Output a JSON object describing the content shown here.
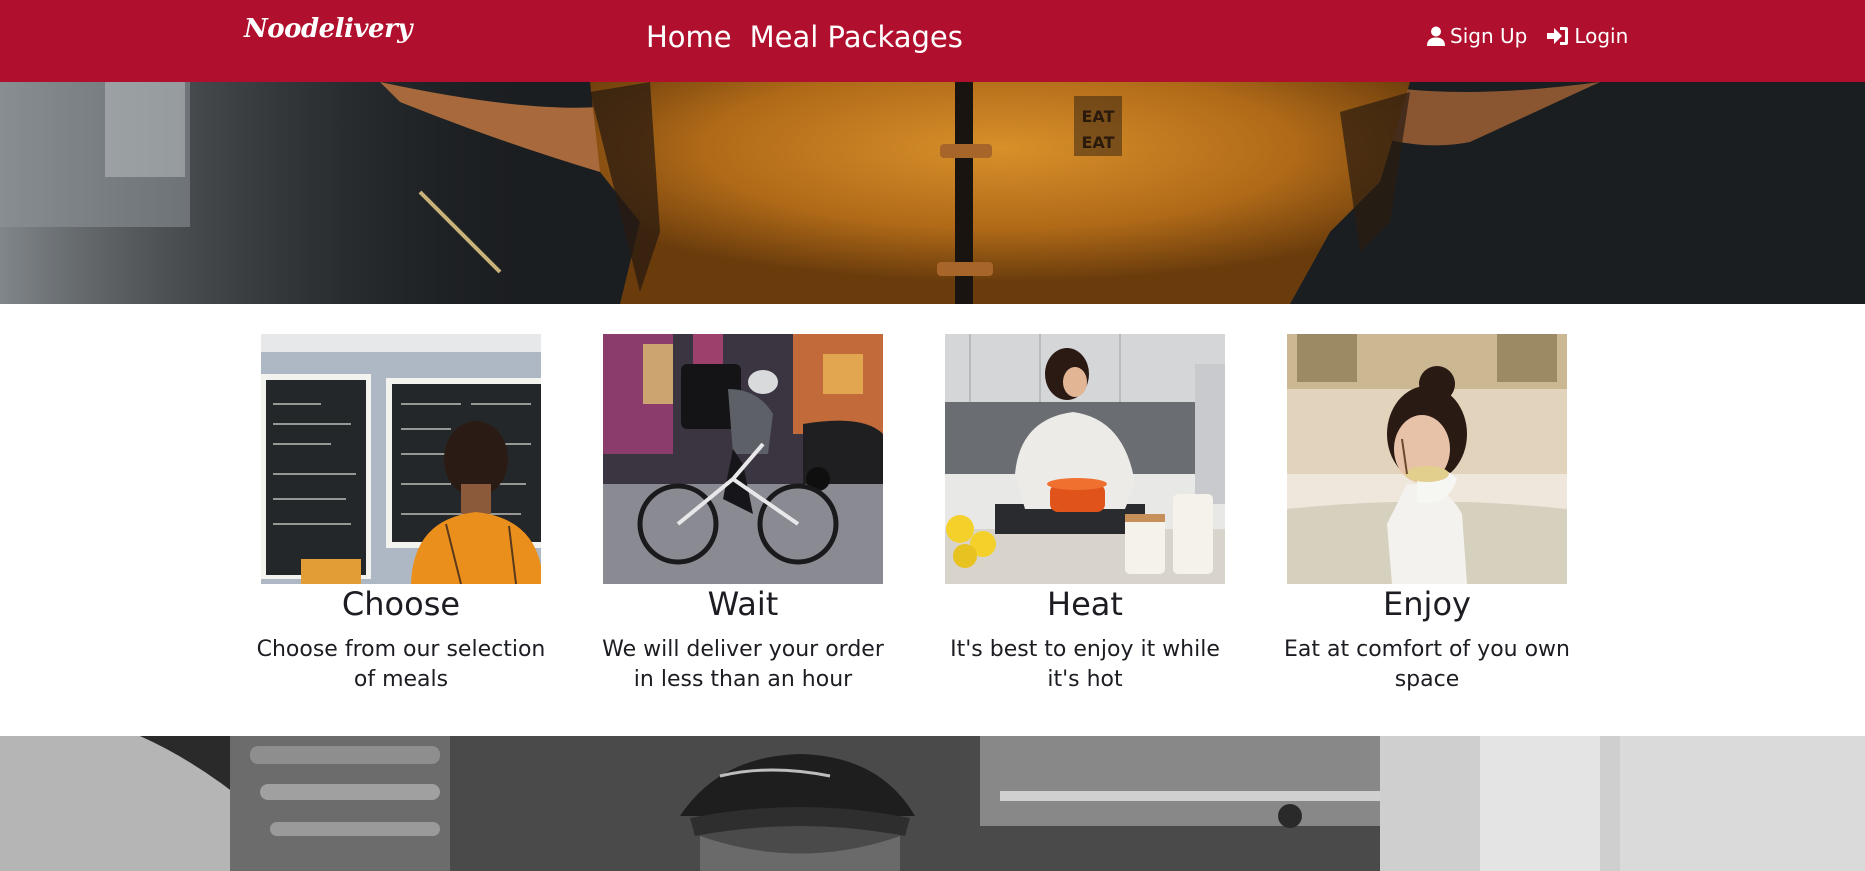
{
  "nav": {
    "brand": "Noodelivery",
    "links": [
      "Home",
      "Meal Packages"
    ],
    "signup_label": "Sign Up",
    "login_label": "Login"
  },
  "steps": [
    {
      "title": "Choose",
      "text": "Choose from our selection of meals"
    },
    {
      "title": "Wait",
      "text": "We will deliver your order in less than an hour"
    },
    {
      "title": "Heat",
      "text": "It's best to enjoy it while it's hot"
    },
    {
      "title": "Enjoy",
      "text": "Eat at comfort of you own space"
    }
  ],
  "hero": {
    "shirt_text": "EAT EAT"
  },
  "colors": {
    "brand": "#b0102d",
    "text": "#1c1c22",
    "shirt": "#c77a1e"
  }
}
